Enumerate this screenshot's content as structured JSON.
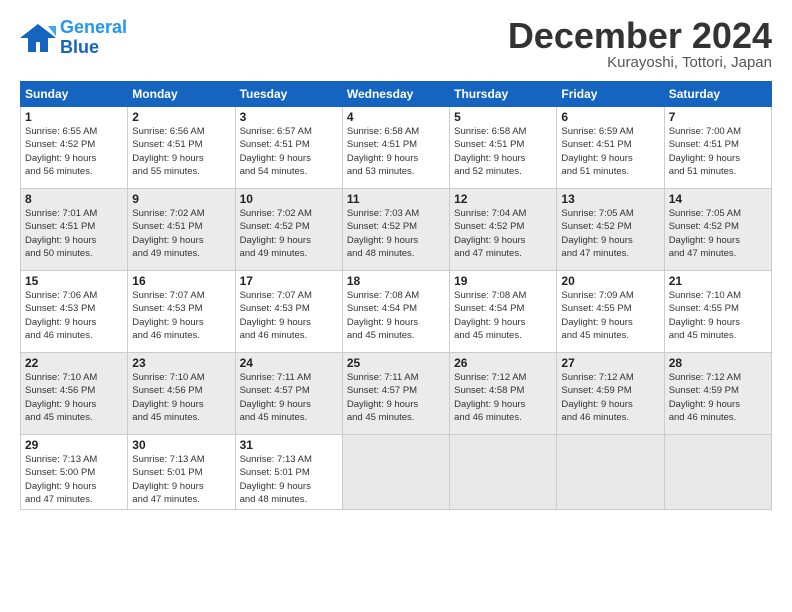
{
  "header": {
    "logo_line1": "General",
    "logo_line2": "Blue",
    "month": "December 2024",
    "location": "Kurayoshi, Tottori, Japan"
  },
  "weekdays": [
    "Sunday",
    "Monday",
    "Tuesday",
    "Wednesday",
    "Thursday",
    "Friday",
    "Saturday"
  ],
  "weeks": [
    [
      {
        "day": "1",
        "info": "Sunrise: 6:55 AM\nSunset: 4:52 PM\nDaylight: 9 hours\nand 56 minutes."
      },
      {
        "day": "2",
        "info": "Sunrise: 6:56 AM\nSunset: 4:51 PM\nDaylight: 9 hours\nand 55 minutes."
      },
      {
        "day": "3",
        "info": "Sunrise: 6:57 AM\nSunset: 4:51 PM\nDaylight: 9 hours\nand 54 minutes."
      },
      {
        "day": "4",
        "info": "Sunrise: 6:58 AM\nSunset: 4:51 PM\nDaylight: 9 hours\nand 53 minutes."
      },
      {
        "day": "5",
        "info": "Sunrise: 6:58 AM\nSunset: 4:51 PM\nDaylight: 9 hours\nand 52 minutes."
      },
      {
        "day": "6",
        "info": "Sunrise: 6:59 AM\nSunset: 4:51 PM\nDaylight: 9 hours\nand 51 minutes."
      },
      {
        "day": "7",
        "info": "Sunrise: 7:00 AM\nSunset: 4:51 PM\nDaylight: 9 hours\nand 51 minutes."
      }
    ],
    [
      {
        "day": "8",
        "info": "Sunrise: 7:01 AM\nSunset: 4:51 PM\nDaylight: 9 hours\nand 50 minutes."
      },
      {
        "day": "9",
        "info": "Sunrise: 7:02 AM\nSunset: 4:51 PM\nDaylight: 9 hours\nand 49 minutes."
      },
      {
        "day": "10",
        "info": "Sunrise: 7:02 AM\nSunset: 4:52 PM\nDaylight: 9 hours\nand 49 minutes."
      },
      {
        "day": "11",
        "info": "Sunrise: 7:03 AM\nSunset: 4:52 PM\nDaylight: 9 hours\nand 48 minutes."
      },
      {
        "day": "12",
        "info": "Sunrise: 7:04 AM\nSunset: 4:52 PM\nDaylight: 9 hours\nand 47 minutes."
      },
      {
        "day": "13",
        "info": "Sunrise: 7:05 AM\nSunset: 4:52 PM\nDaylight: 9 hours\nand 47 minutes."
      },
      {
        "day": "14",
        "info": "Sunrise: 7:05 AM\nSunset: 4:52 PM\nDaylight: 9 hours\nand 47 minutes."
      }
    ],
    [
      {
        "day": "15",
        "info": "Sunrise: 7:06 AM\nSunset: 4:53 PM\nDaylight: 9 hours\nand 46 minutes."
      },
      {
        "day": "16",
        "info": "Sunrise: 7:07 AM\nSunset: 4:53 PM\nDaylight: 9 hours\nand 46 minutes."
      },
      {
        "day": "17",
        "info": "Sunrise: 7:07 AM\nSunset: 4:53 PM\nDaylight: 9 hours\nand 46 minutes."
      },
      {
        "day": "18",
        "info": "Sunrise: 7:08 AM\nSunset: 4:54 PM\nDaylight: 9 hours\nand 45 minutes."
      },
      {
        "day": "19",
        "info": "Sunrise: 7:08 AM\nSunset: 4:54 PM\nDaylight: 9 hours\nand 45 minutes."
      },
      {
        "day": "20",
        "info": "Sunrise: 7:09 AM\nSunset: 4:55 PM\nDaylight: 9 hours\nand 45 minutes."
      },
      {
        "day": "21",
        "info": "Sunrise: 7:10 AM\nSunset: 4:55 PM\nDaylight: 9 hours\nand 45 minutes."
      }
    ],
    [
      {
        "day": "22",
        "info": "Sunrise: 7:10 AM\nSunset: 4:56 PM\nDaylight: 9 hours\nand 45 minutes."
      },
      {
        "day": "23",
        "info": "Sunrise: 7:10 AM\nSunset: 4:56 PM\nDaylight: 9 hours\nand 45 minutes."
      },
      {
        "day": "24",
        "info": "Sunrise: 7:11 AM\nSunset: 4:57 PM\nDaylight: 9 hours\nand 45 minutes."
      },
      {
        "day": "25",
        "info": "Sunrise: 7:11 AM\nSunset: 4:57 PM\nDaylight: 9 hours\nand 45 minutes."
      },
      {
        "day": "26",
        "info": "Sunrise: 7:12 AM\nSunset: 4:58 PM\nDaylight: 9 hours\nand 46 minutes."
      },
      {
        "day": "27",
        "info": "Sunrise: 7:12 AM\nSunset: 4:59 PM\nDaylight: 9 hours\nand 46 minutes."
      },
      {
        "day": "28",
        "info": "Sunrise: 7:12 AM\nSunset: 4:59 PM\nDaylight: 9 hours\nand 46 minutes."
      }
    ],
    [
      {
        "day": "29",
        "info": "Sunrise: 7:13 AM\nSunset: 5:00 PM\nDaylight: 9 hours\nand 47 minutes."
      },
      {
        "day": "30",
        "info": "Sunrise: 7:13 AM\nSunset: 5:01 PM\nDaylight: 9 hours\nand 47 minutes."
      },
      {
        "day": "31",
        "info": "Sunrise: 7:13 AM\nSunset: 5:01 PM\nDaylight: 9 hours\nand 48 minutes."
      },
      {
        "day": "",
        "info": ""
      },
      {
        "day": "",
        "info": ""
      },
      {
        "day": "",
        "info": ""
      },
      {
        "day": "",
        "info": ""
      }
    ]
  ]
}
